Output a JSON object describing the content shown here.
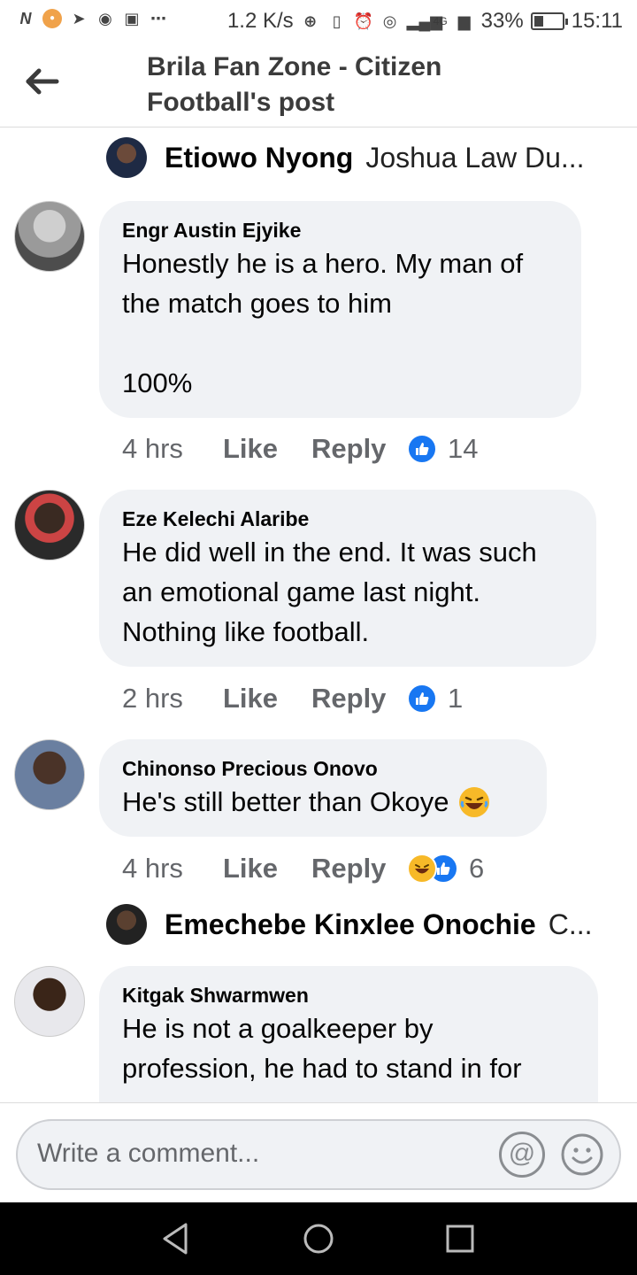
{
  "status_bar": {
    "net_speed": "1.2 K/s",
    "network": "4G",
    "battery": "33%",
    "battery_level": 0.33,
    "time": "15:11"
  },
  "header": {
    "title": "Brila Fan Zone - Citizen Football's post"
  },
  "reply_previews": [
    {
      "name": "Etiowo Nyong",
      "text": "Joshua Law Du..."
    },
    {
      "name": "Emechebe Kinxlee Onochie",
      "text": "C..."
    }
  ],
  "comments": [
    {
      "author": "Engr Austin Ejyike",
      "text": "Honestly he is a hero. My man of\nthe match goes to him\n\n100%",
      "time": "4 hrs",
      "like": "Like",
      "reply": "Reply",
      "reaction_count": "14",
      "reactions": [
        "like"
      ]
    },
    {
      "author": "Eze Kelechi Alaribe",
      "text": "He did well in the end. It was such\nan emotional game last night.\nNothing like football.",
      "time": "2 hrs",
      "like": "Like",
      "reply": "Reply",
      "reaction_count": "1",
      "reactions": [
        "like"
      ]
    },
    {
      "author": "Chinonso Precious Onovo",
      "text": "He's still better than Okoye",
      "time": "4 hrs",
      "like": "Like",
      "reply": "Reply",
      "reaction_count": "6",
      "reactions": [
        "haha",
        "like"
      ]
    },
    {
      "author": "Kitgak Shwarmwen",
      "text": "He is not a goalkeeper by\nprofession, he had to stand in for",
      "time": "",
      "like": "",
      "reply": "",
      "reaction_count": "",
      "reactions": []
    }
  ],
  "composer": {
    "placeholder": "Write a comment..."
  },
  "colors": {
    "accent": "#1877f2",
    "bubble": "#f0f2f5",
    "meta_text": "#65676b"
  }
}
